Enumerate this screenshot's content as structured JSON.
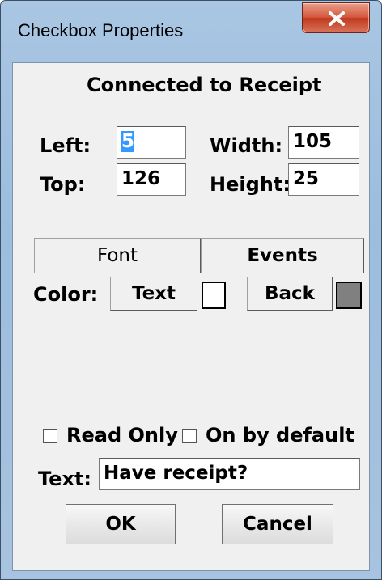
{
  "window": {
    "title": "Checkbox Properties"
  },
  "header": {
    "connected_label": "Connected to Receipt"
  },
  "position": {
    "left_label": "Left:",
    "left_value": "5",
    "top_label": "Top:",
    "top_value": "126",
    "width_label": "Width:",
    "width_value": "105",
    "height_label": "Height:",
    "height_value": "25"
  },
  "buttons": {
    "font": "Font",
    "events": "Events",
    "text_color": "Text",
    "back_color": "Back",
    "ok": "OK",
    "cancel": "Cancel"
  },
  "color_row": {
    "label": "Color:",
    "text_swatch": "#ffffff",
    "back_swatch": "#808080"
  },
  "options": {
    "read_only": "Read Only",
    "on_by_default": "On by default",
    "read_only_checked": false,
    "on_by_default_checked": false
  },
  "text_field": {
    "label": "Text:",
    "value": "Have receipt?"
  },
  "icons": {
    "close": "close-icon"
  }
}
